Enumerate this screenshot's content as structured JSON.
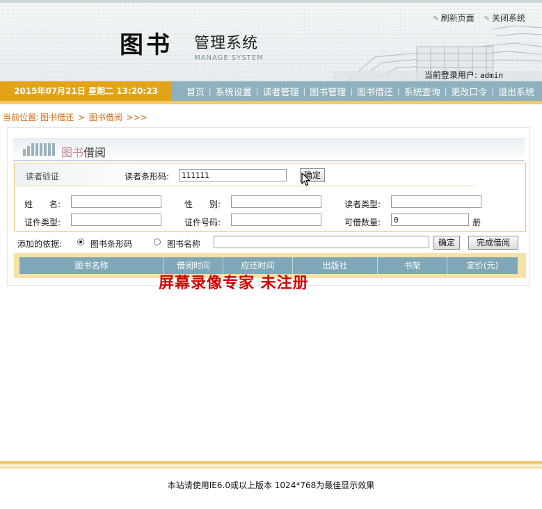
{
  "header": {
    "logo_main": "图书",
    "logo_sub": "管理系统",
    "logo_en": "MANAGE SYSTEM",
    "top_links": [
      "刷新页面",
      "关闭系统"
    ],
    "login_label": "当前登录用户:",
    "login_user": "admin"
  },
  "navbar": {
    "datetime": "2015年07月21日 星期二 13:20:23",
    "items": [
      "首页",
      "系统设置",
      "读者管理",
      "图书管理",
      "图书借还",
      "系统查询",
      "更改口令",
      "退出系统"
    ]
  },
  "breadcrumb": {
    "label": "当前位置:",
    "path1": "图书借还",
    "sep": ">",
    "path2": "图书借阅",
    "tail": ">>>"
  },
  "panel": {
    "title_part1": "图书",
    "title_part2": "借阅"
  },
  "reader_verify": {
    "section_label": "读者验证",
    "barcode_label": "读者条形码:",
    "barcode_value": "111111",
    "confirm_label": "确定"
  },
  "reader_info": {
    "name_label": "姓　　名:",
    "name_value": "",
    "gender_label": "性　　别:",
    "gender_value": "",
    "type_label": "读者类型:",
    "type_value": "",
    "id_type_label": "证件类型:",
    "id_type_value": "",
    "id_no_label": "证件号码:",
    "id_no_value": "",
    "borrowable_label": "可借数量:",
    "borrowable_value": "0",
    "borrowable_unit": "册"
  },
  "add_by": {
    "label": "添加的依据:",
    "option_barcode": "图书条形码",
    "option_name": "图书名称",
    "selected": "图书条形码",
    "value": "",
    "confirm_label": "确定",
    "finish_label": "完成借阅"
  },
  "table": {
    "columns": [
      "图书名称",
      "借阅时间",
      "应还时间",
      "出版社",
      "书架",
      "定价(元)"
    ]
  },
  "watermark": "屏幕录像专家 未注册",
  "footer": {
    "text": "本站请使用IE6.0或以上版本 1024*768为最佳显示效果"
  },
  "colors": {
    "nav_bg": "#8fb0be",
    "date_bg": "#e3a316",
    "breadcrumb": "#d56b14",
    "table_header": "#7ea7b7",
    "watermark": "#d60000"
  }
}
